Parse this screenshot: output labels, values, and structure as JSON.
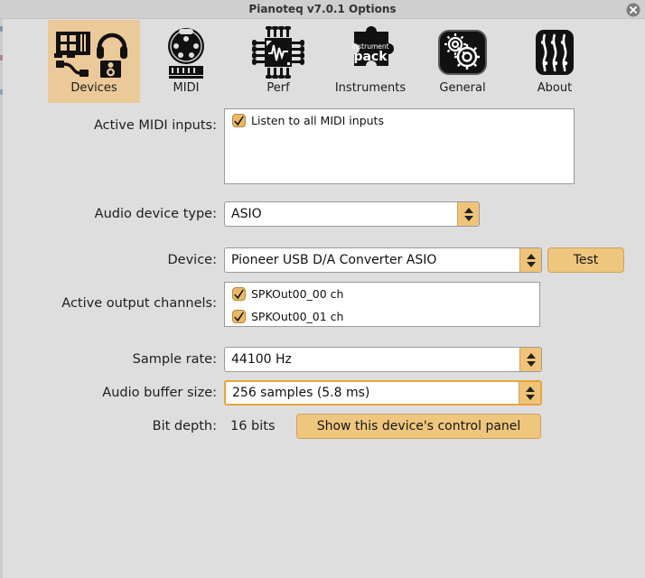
{
  "window": {
    "title": "Pianoteq v7.0.1 Options",
    "close_icon": "close-circle-icon"
  },
  "theme": {
    "background": "#dedede",
    "titlebar": "#cfcfcf",
    "accent": "#efc67e",
    "tab_selected": "#ecc999",
    "spinner": "#f0c478",
    "focus_border": "#e8a33d",
    "field_background": "#ffffff",
    "text": "#1d1d1d"
  },
  "tabs": [
    {
      "id": "devices",
      "label": "Devices",
      "icon": "devices-icon",
      "selected": true
    },
    {
      "id": "midi",
      "label": "MIDI",
      "icon": "midi-din-icon",
      "selected": false
    },
    {
      "id": "perf",
      "label": "Perf",
      "icon": "cpu-chip-icon",
      "selected": false
    },
    {
      "id": "instruments",
      "label": "Instruments",
      "icon": "puzzle-pack-icon",
      "selected": false
    },
    {
      "id": "general",
      "label": "General",
      "icon": "gears-icon",
      "selected": false
    },
    {
      "id": "about",
      "label": "About",
      "icon": "strings-icon",
      "selected": false
    }
  ],
  "form": {
    "midi_inputs": {
      "label": "Active MIDI inputs:",
      "items": [
        {
          "label": "Listen to all MIDI inputs",
          "checked": true
        }
      ]
    },
    "audio_device_type": {
      "label": "Audio device type:",
      "value": "ASIO",
      "focused": false
    },
    "device": {
      "label": "Device:",
      "value": "Pioneer USB D/A Converter ASIO",
      "focused": false,
      "test_button": "Test"
    },
    "output_channels": {
      "label": "Active output channels:",
      "items": [
        {
          "label": "SPKOut00_00 ch",
          "checked": true
        },
        {
          "label": "SPKOut00_01 ch",
          "checked": true
        }
      ]
    },
    "sample_rate": {
      "label": "Sample rate:",
      "value": "44100 Hz",
      "focused": false
    },
    "buffer_size": {
      "label": "Audio buffer size:",
      "value": "256 samples (5.8 ms)",
      "focused": true
    },
    "bit_depth": {
      "label": "Bit depth:",
      "value": "16 bits"
    },
    "control_panel_button": "Show this device's control panel"
  }
}
